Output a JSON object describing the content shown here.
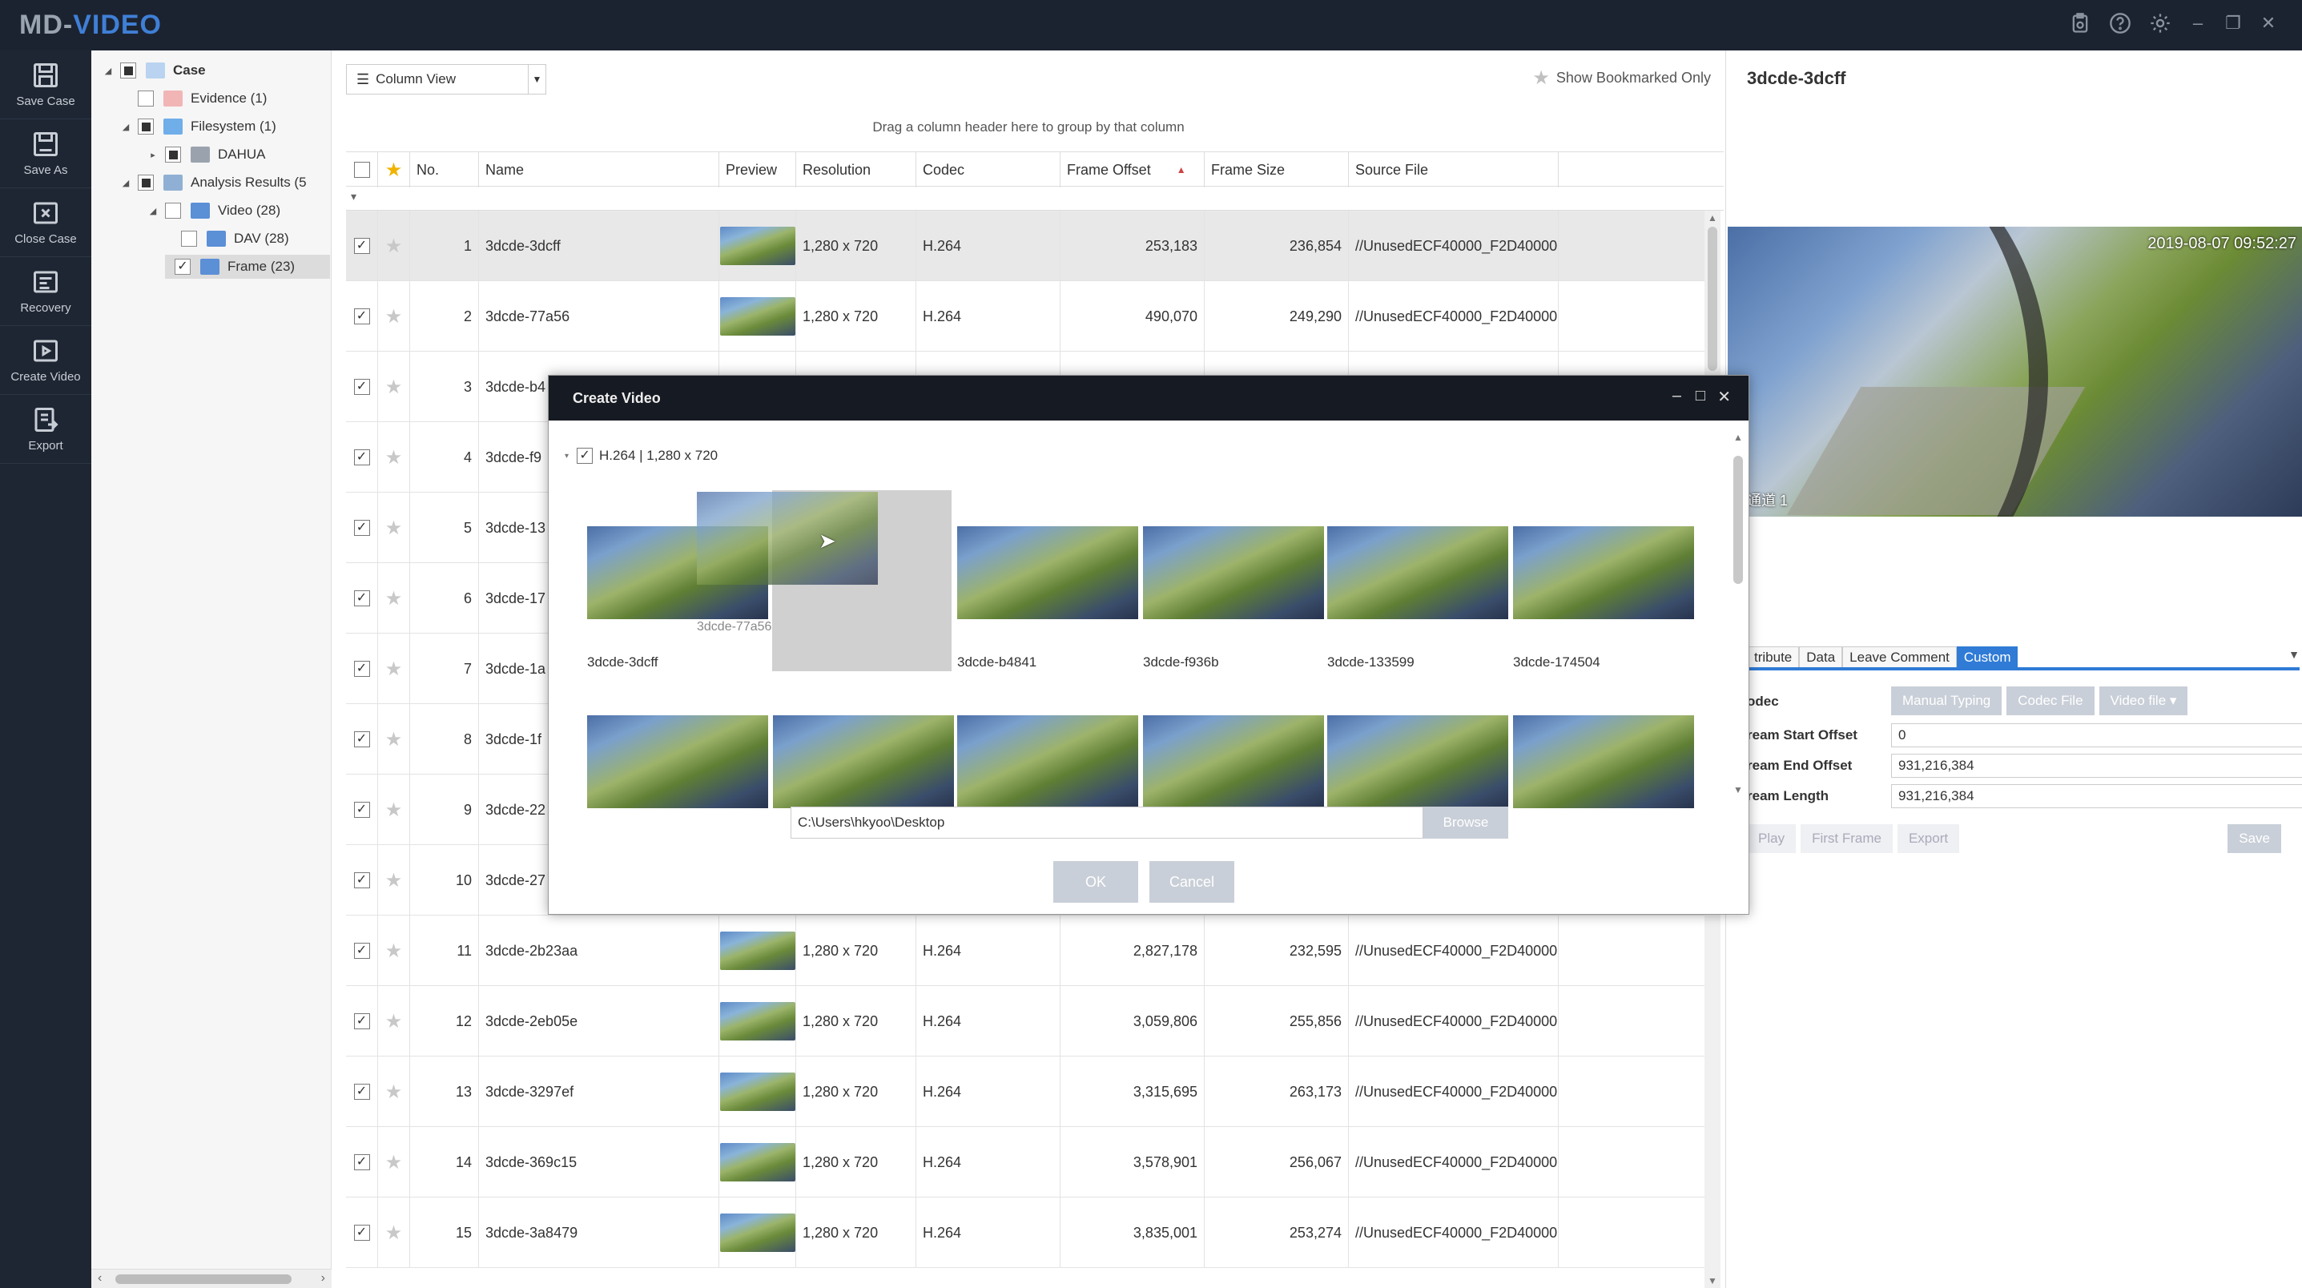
{
  "app": {
    "logo_md": "MD-",
    "logo_video": "VIDEO"
  },
  "toolbar": {
    "items": [
      {
        "label": "Save Case",
        "icon": "save-icon"
      },
      {
        "label": "Save As",
        "icon": "save-as-icon"
      },
      {
        "label": "Close Case",
        "icon": "close-case-icon"
      },
      {
        "label": "Recovery",
        "icon": "recovery-icon"
      },
      {
        "label": "Create Video",
        "icon": "create-video-icon"
      },
      {
        "label": "Export",
        "icon": "export-icon"
      }
    ]
  },
  "tree": {
    "items": [
      {
        "label": "Case",
        "bold": true
      },
      {
        "label": "Evidence (1)"
      },
      {
        "label": "Filesystem (1)"
      },
      {
        "label": "DAHUA"
      },
      {
        "label": "Analysis Results (5"
      },
      {
        "label": "Video (28)"
      },
      {
        "label": "DAV (28)"
      },
      {
        "label": "Frame (23)"
      }
    ]
  },
  "main": {
    "view_select": "Column View",
    "bookmark_label": "Show Bookmarked Only",
    "group_hint": "Drag a column header here to group by that column",
    "columns": [
      "No.",
      "Name",
      "Preview",
      "Resolution",
      "Codec",
      "Frame Offset",
      "Frame Size",
      "Source File"
    ],
    "rows": [
      {
        "no": "1",
        "name": "3dcde-3dcff",
        "res": "1,280 x 720",
        "codec": "H.264",
        "offset": "253,183",
        "size": "236,854",
        "source": "//UnusedECF40000_F2D40000"
      },
      {
        "no": "2",
        "name": "3dcde-77a56",
        "res": "1,280 x 720",
        "codec": "H.264",
        "offset": "490,070",
        "size": "249,290",
        "source": "//UnusedECF40000_F2D40000"
      },
      {
        "no": "3",
        "name": "3dcde-b4",
        "res": "",
        "codec": "",
        "offset": "",
        "size": "",
        "source": ""
      },
      {
        "no": "4",
        "name": "3dcde-f9",
        "res": "",
        "codec": "",
        "offset": "",
        "size": "",
        "source": ""
      },
      {
        "no": "5",
        "name": "3dcde-13",
        "res": "",
        "codec": "",
        "offset": "",
        "size": "",
        "source": ""
      },
      {
        "no": "6",
        "name": "3dcde-17",
        "res": "",
        "codec": "",
        "offset": "",
        "size": "",
        "source": ""
      },
      {
        "no": "7",
        "name": "3dcde-1a",
        "res": "",
        "codec": "",
        "offset": "",
        "size": "",
        "source": ""
      },
      {
        "no": "8",
        "name": "3dcde-1f",
        "res": "",
        "codec": "",
        "offset": "",
        "size": "",
        "source": ""
      },
      {
        "no": "9",
        "name": "3dcde-22",
        "res": "",
        "codec": "",
        "offset": "",
        "size": "",
        "source": ""
      },
      {
        "no": "10",
        "name": "3dcde-27",
        "res": "",
        "codec": "",
        "offset": "",
        "size": "",
        "source": ""
      },
      {
        "no": "11",
        "name": "3dcde-2b23aa",
        "res": "1,280 x 720",
        "codec": "H.264",
        "offset": "2,827,178",
        "size": "232,595",
        "source": "//UnusedECF40000_F2D40000"
      },
      {
        "no": "12",
        "name": "3dcde-2eb05e",
        "res": "1,280 x 720",
        "codec": "H.264",
        "offset": "3,059,806",
        "size": "255,856",
        "source": "//UnusedECF40000_F2D40000"
      },
      {
        "no": "13",
        "name": "3dcde-3297ef",
        "res": "1,280 x 720",
        "codec": "H.264",
        "offset": "3,315,695",
        "size": "263,173",
        "source": "//UnusedECF40000_F2D40000"
      },
      {
        "no": "14",
        "name": "3dcde-369c15",
        "res": "1,280 x 720",
        "codec": "H.264",
        "offset": "3,578,901",
        "size": "256,067",
        "source": "//UnusedECF40000_F2D40000"
      },
      {
        "no": "15",
        "name": "3dcde-3a8479",
        "res": "1,280 x 720",
        "codec": "H.264",
        "offset": "3,835,001",
        "size": "253,274",
        "source": "//UnusedECF40000_F2D40000"
      }
    ]
  },
  "detail": {
    "title": "3dcde-3dcff",
    "timestamp": "2019-08-07 09:52:27",
    "channel": "通道 1",
    "tabs": [
      "tribute",
      "Data",
      "Leave Comment",
      "Custom"
    ],
    "codec_label": "odec",
    "codec_buttons": [
      "Manual Typing",
      "Codec File",
      "Video file ▾"
    ],
    "props": [
      {
        "label": "ream Start Offset",
        "value": "0"
      },
      {
        "label": "ream End Offset",
        "value": "931,216,384"
      },
      {
        "label": "ream Length",
        "value": "931,216,384"
      }
    ],
    "play_buttons": [
      "Play",
      "First Frame",
      "Export"
    ],
    "save_label": "Save"
  },
  "modal": {
    "title": "Create Video",
    "group_label": "H.264  |  1,280 x 720",
    "frames_row1": [
      "3dcde-3dcff",
      "",
      "3dcde-b4841",
      "3dcde-f936b",
      "3dcde-133599",
      "3dcde-174504"
    ],
    "ghost_label": "3dcde-77a56",
    "path_value": "C:\\Users\\hkyoo\\Desktop",
    "browse_label": "Browse",
    "ok_label": "OK",
    "cancel_label": "Cancel"
  }
}
